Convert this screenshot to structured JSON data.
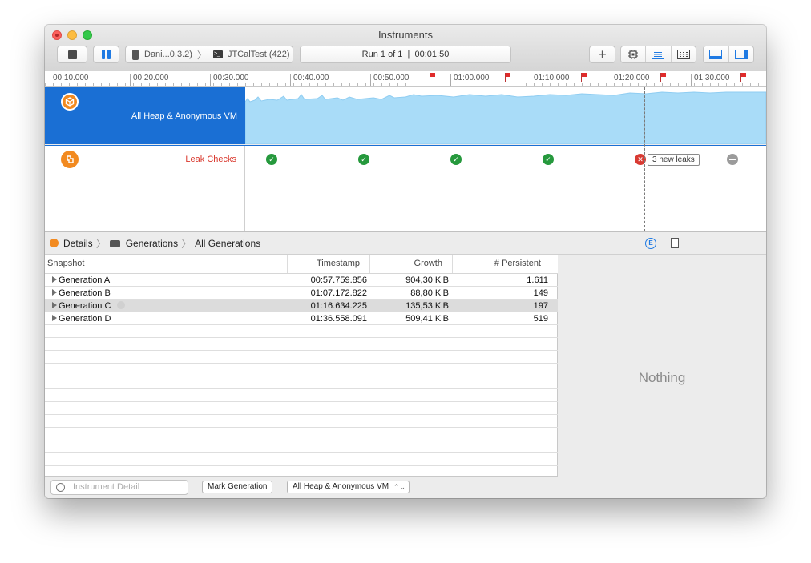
{
  "window": {
    "title": "Instruments"
  },
  "toolbar": {
    "device": "Dani...0.3.2)",
    "target": "JTCalTest (422)",
    "run_info": "Run 1 of 1  |  00:01:50",
    "add_symbol": "+"
  },
  "ruler": {
    "ticks": [
      "00:10.000",
      "00:20.000",
      "00:30.000",
      "00:40.000",
      "00:50.000",
      "01:00.000",
      "01:10.000",
      "01:20.000",
      "01:30.000"
    ]
  },
  "tracks": {
    "heap_label": "All Heap & Anonymous VM",
    "leak_label": "Leak Checks",
    "leak_checks": [
      {
        "status": "ok",
        "at": "00:33.3"
      },
      {
        "status": "ok",
        "at": "00:44.8"
      },
      {
        "status": "ok",
        "at": "00:56.3"
      },
      {
        "status": "ok",
        "at": "01:07.8"
      },
      {
        "status": "error",
        "at": "01:19.3"
      },
      {
        "status": "none",
        "at": "01:30.8"
      }
    ],
    "leak_tag": "3 new leaks"
  },
  "jumpbar": {
    "items": [
      "Details",
      "Generations",
      "All Generations"
    ]
  },
  "table": {
    "columns": [
      "Snapshot",
      "Timestamp",
      "Growth",
      "# Persistent"
    ],
    "rows": [
      {
        "snapshot": "Generation A",
        "timestamp": "00:57.759.856",
        "growth": "904,30 KiB",
        "persistent": "1.611"
      },
      {
        "snapshot": "Generation B",
        "timestamp": "01:07.172.822",
        "growth": "88,80 KiB",
        "persistent": "149"
      },
      {
        "snapshot": "Generation C",
        "timestamp": "01:16.634.225",
        "growth": "135,53 KiB",
        "persistent": "197"
      },
      {
        "snapshot": "Generation D",
        "timestamp": "01:36.558.091",
        "growth": "509,41 KiB",
        "persistent": "519"
      }
    ],
    "selected_row": 2
  },
  "bottombar": {
    "filter_placeholder": "Instrument Detail",
    "mark_button": "Mark Generation",
    "instrument_select": "All Heap & Anonymous VM"
  },
  "inspector": {
    "empty_text": "Nothing"
  },
  "colors": {
    "accent": "#1a6fd4",
    "heap_fill": "#a9dcf8",
    "ok": "#26993d",
    "error": "#d93a32"
  }
}
